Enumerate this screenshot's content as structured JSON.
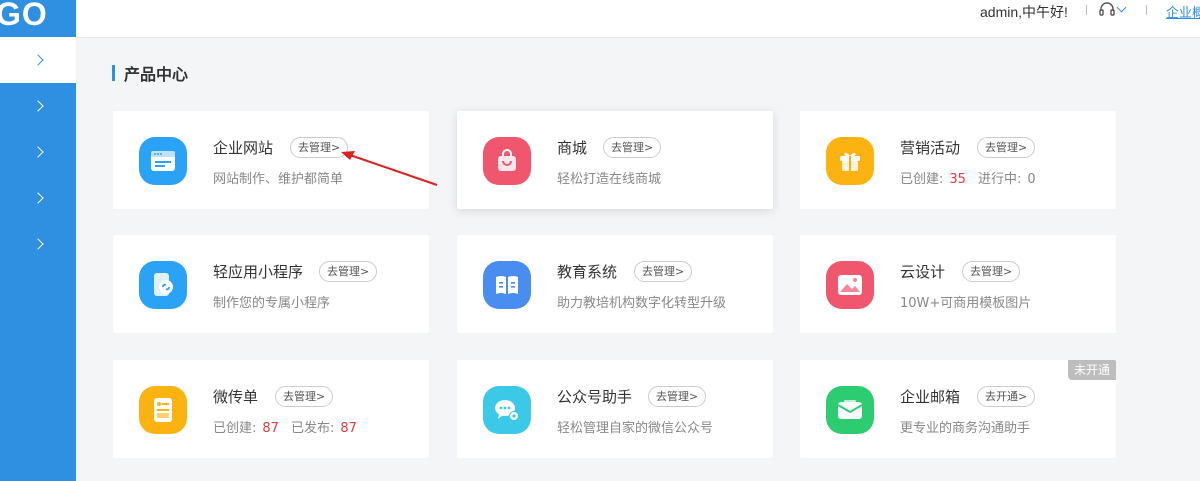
{
  "logo": {
    "text": "GO"
  },
  "header": {
    "greeting": "admin,中午好!",
    "enterprise_link": "企业概况"
  },
  "sidebar": {
    "items": [
      {
        "icon": "chevron-right-icon",
        "active": true
      },
      {
        "icon": "chevron-right-icon",
        "active": false
      },
      {
        "icon": "chevron-right-icon",
        "active": false
      },
      {
        "icon": "chevron-right-icon",
        "active": false
      },
      {
        "icon": "chevron-right-icon",
        "active": false
      }
    ]
  },
  "main": {
    "section_title": "产品中心",
    "cards": [
      {
        "name": "企业网站",
        "action": "去管理>",
        "desc": "网站制作、维护都简单",
        "icon": "website-icon",
        "color": "#2aa2f5"
      },
      {
        "name": "商城",
        "action": "去管理>",
        "desc": "轻松打造在线商城",
        "icon": "shopping-bag-icon",
        "color": "#f0566e"
      },
      {
        "name": "营销活动",
        "action": "去管理>",
        "desc_label1": "已创建:",
        "desc_value1": "35",
        "desc_label2": "进行中:",
        "desc_value2": "0",
        "icon": "gift-icon",
        "color": "#fcb312"
      },
      {
        "name": "轻应用小程序",
        "action": "去管理>",
        "desc": "制作您的专属小程序",
        "icon": "mini-program-icon",
        "color": "#2aa2f5"
      },
      {
        "name": "教育系统",
        "action": "去管理>",
        "desc": "助力教培机构数字化转型升级",
        "icon": "book-icon",
        "color": "#4a8df0"
      },
      {
        "name": "云设计",
        "action": "去管理>",
        "desc": "10W+可商用模板图片",
        "icon": "image-icon",
        "color": "#f0566e"
      },
      {
        "name": "微传单",
        "action": "去管理>",
        "desc_label1": "已创建:",
        "desc_value1": "87",
        "desc_label2": "已发布:",
        "desc_value2": "87",
        "icon": "flyer-icon",
        "color": "#fcb312"
      },
      {
        "name": "公众号助手",
        "action": "去管理>",
        "desc": "轻松管理自家的微信公众号",
        "icon": "wechat-icon",
        "color": "#3cc9e8"
      },
      {
        "name": "企业邮箱",
        "action": "去开通>",
        "desc": "更专业的商务沟通助手",
        "badge": "未开通",
        "icon": "mail-icon",
        "color": "#2ecc71"
      }
    ]
  },
  "colors": {
    "accent": "#2f8fe0",
    "number": "#e4393c",
    "annotation_arrow": "#e02020"
  }
}
